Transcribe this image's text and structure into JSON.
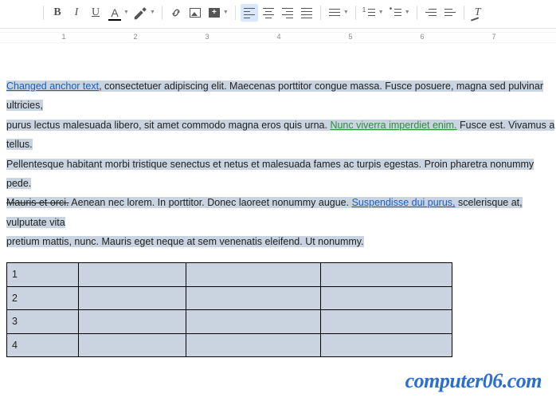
{
  "toolbar": {
    "bold": "B",
    "italic": "I",
    "underline": "U",
    "textcolor": "A",
    "insert_plus": "+"
  },
  "ruler": {
    "marks": [
      "1",
      "2",
      "3",
      "4",
      "5",
      "6",
      "7"
    ]
  },
  "paragraph": {
    "link1": "Changed anchor text",
    "seg1": ", consectetuer adipiscing elit. Maecenas porttitor congue massa. Fusce posuere, magna sed pulvinar ultricies,",
    "seg2": "purus lectus malesuada libero, sit amet commodo magna eros quis urna. ",
    "greenlink": "Nunc viverra imperdiet enim.",
    "seg3": " Fusce est. Vivamus a tellus.",
    "seg4": "Pellentesque habitant morbi tristique senectus et netus et malesuada fames ac turpis egestas. Proin pharetra nonummy pede.",
    "strike": "Mauris et orci.",
    "seg5": " Aenean nec lorem. In porttitor. Donec laoreet nonummy augue. ",
    "link2": "Suspendisse dui purus,",
    "seg6": " scelerisque at, vulputate vita",
    "seg7": "pretium mattis, nunc. Mauris eget neque at sem venenatis eleifend. Ut nonummy."
  },
  "table": {
    "rows": [
      {
        "c0": "1",
        "c1": "",
        "c2": "",
        "c3": ""
      },
      {
        "c0": "2",
        "c1": "",
        "c2": "",
        "c3": ""
      },
      {
        "c0": "3",
        "c1": "",
        "c2": "",
        "c3": ""
      },
      {
        "c0": "4",
        "c1": "",
        "c2": "",
        "c3": ""
      }
    ]
  },
  "watermark": "computer06.com"
}
